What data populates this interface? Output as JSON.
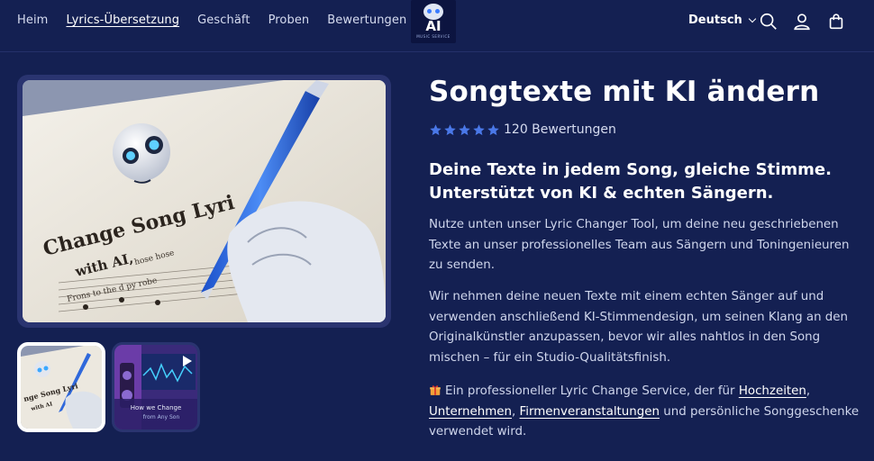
{
  "nav": {
    "items": [
      {
        "label": "Heim",
        "active": false
      },
      {
        "label": "Lyrics-Übersetzung",
        "active": true
      },
      {
        "label": "Geschäft",
        "active": false
      },
      {
        "label": "Proben",
        "active": false
      },
      {
        "label": "Bewertungen",
        "active": false
      }
    ]
  },
  "logo": {
    "text": "AI",
    "subtext": "MUSIC SERVICE"
  },
  "header": {
    "language": "Deutsch",
    "icons": [
      "search-icon",
      "account-icon",
      "cart-icon"
    ]
  },
  "gallery": {
    "main_image_alt": "Change Song Lyrics with AI",
    "thumbnails": [
      {
        "label": "Change Song Lyrics with AI",
        "selected": true
      },
      {
        "label": "How we Change from Any Son",
        "selected": false
      }
    ]
  },
  "product": {
    "title": "Songtexte mit KI ändern",
    "rating": {
      "stars": 5,
      "count_text": "120 Bewertungen"
    },
    "subtitle_line1": "Deine Texte in jedem Song, gleiche Stimme.",
    "subtitle_line2": "Unterstützt von KI & echten Sängern.",
    "paragraph1": "Nutze unten unser Lyric Changer Tool, um deine neu geschriebenen Texte an unser professionelles Team aus Sängern und Toningenieuren zu senden.",
    "paragraph2": "Wir nehmen deine neuen Texte mit einem echten Sänger auf und verwenden anschließend KI-Stimmendesign, um seinen Klang an den Originalkünstler anzupassen, bevor wir alles nahtlos in den Song mischen – für ein Studio-Qualitätsfinish.",
    "paragraph3": {
      "prefix": "Ein professioneller Lyric Change Service, der für ",
      "link1": "Hochzeiten",
      "sep1": ", ",
      "link2": "Unternehmen",
      "sep2": ", ",
      "link3": "Firmenveranstaltungen",
      "suffix": " und persönliche Songgeschenke verwendet wird."
    }
  },
  "colors": {
    "background": "#142052",
    "star": "#4a78e8",
    "text": "#cfd6ec"
  }
}
